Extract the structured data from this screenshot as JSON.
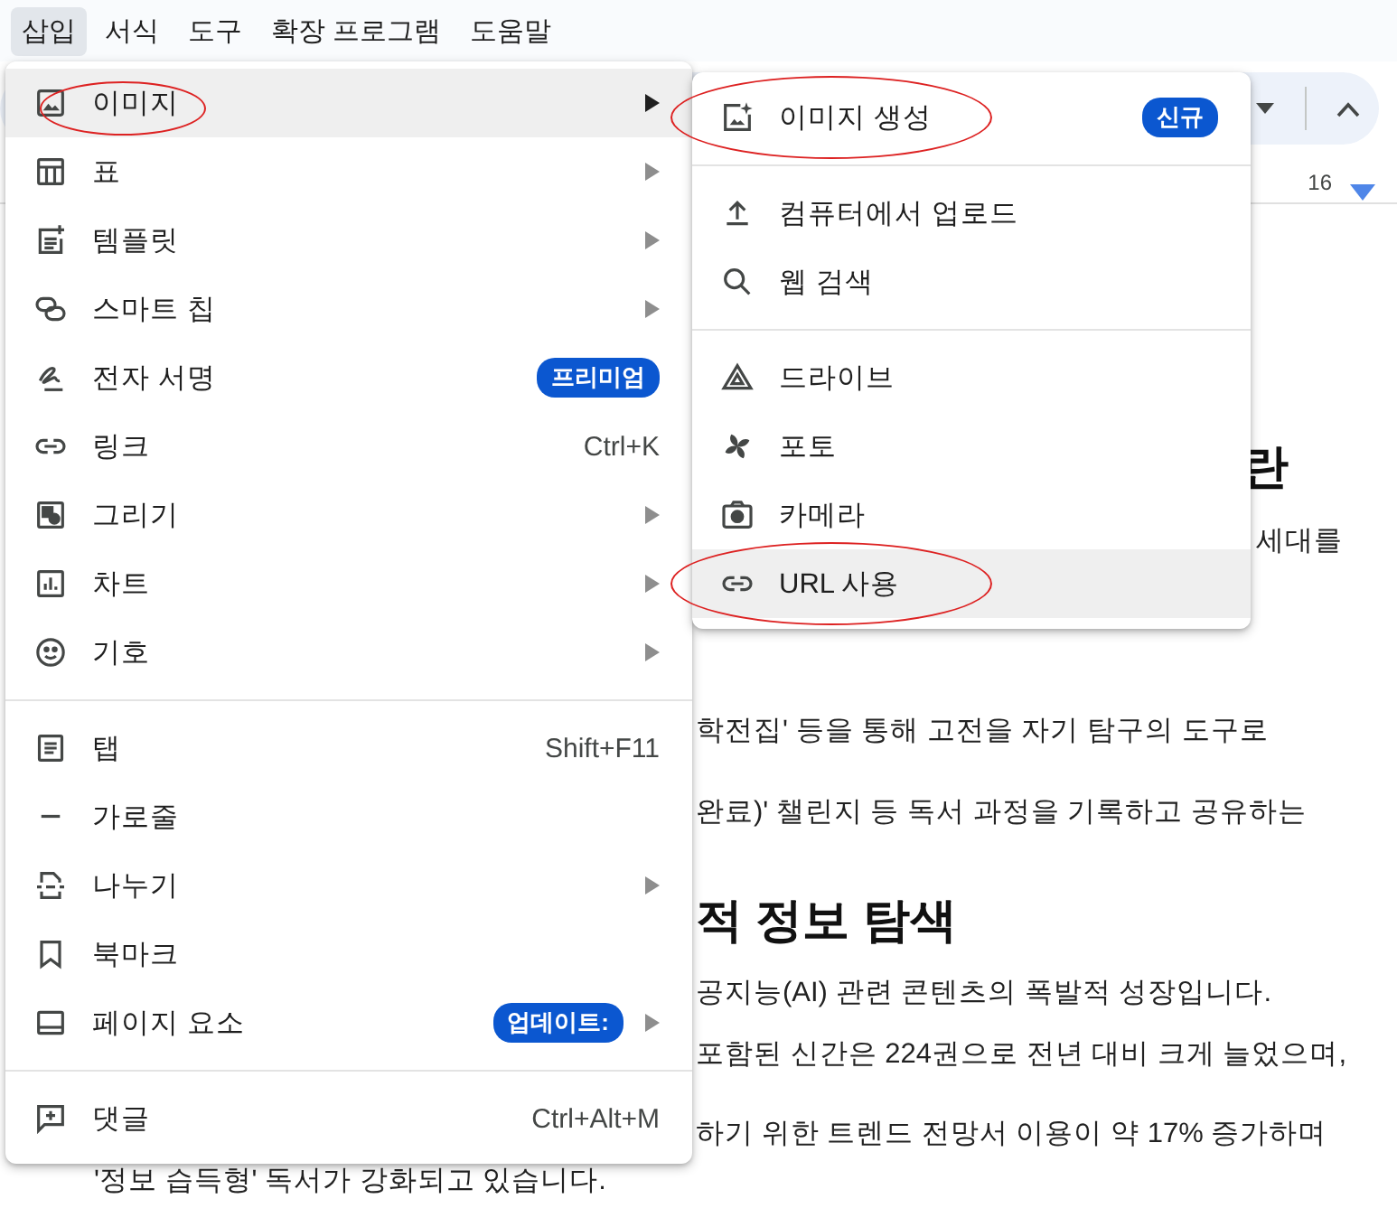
{
  "menubar": [
    {
      "label": "삽입",
      "selected": true
    },
    {
      "label": "서식",
      "selected": false
    },
    {
      "label": "도구",
      "selected": false
    },
    {
      "label": "확장 프로그램",
      "selected": false
    },
    {
      "label": "도움말",
      "selected": false
    }
  ],
  "ruler": {
    "tick_label": "16"
  },
  "document": {
    "lines": [
      {
        "kind": "heading",
        "text": "란"
      },
      {
        "kind": "text",
        "text": "세대를"
      },
      {
        "kind": "text",
        "text": "학전집' 등을 통해 고전을 자기 탐구의 도구로"
      },
      {
        "kind": "text",
        "text": "완료)' 챌린지 등 독서 과정을 기록하고 공유하는"
      },
      {
        "kind": "heading",
        "text": "적 정보 탐색"
      },
      {
        "kind": "text",
        "text": "공지능(AI) 관련 콘텐츠의 폭발적 성장입니다."
      },
      {
        "kind": "text",
        "text": "포함된 신간은 224권으로 전년 대비 크게 늘었으며,"
      },
      {
        "kind": "text",
        "text": "하기 위한 트렌드 전망서 이용이 약 17% 증가하며"
      },
      {
        "kind": "text",
        "text": "'정보 습득형' 독서가 강화되고 있습니다."
      }
    ]
  },
  "insert_menu": {
    "groups": [
      {
        "items": [
          {
            "label": "이미지",
            "has_submenu": true,
            "highlighted": true,
            "circled": true
          },
          {
            "label": "표",
            "has_submenu": true,
            "highlighted": false,
            "circled": false
          },
          {
            "label": "템플릿",
            "has_submenu": true,
            "highlighted": false,
            "circled": false
          },
          {
            "label": "스마트 칩",
            "has_submenu": true,
            "highlighted": false,
            "circled": false
          },
          {
            "label": "전자 서명",
            "badge": "프리미엄",
            "has_submenu": false,
            "highlighted": false,
            "circled": false
          },
          {
            "label": "링크",
            "shortcut": "Ctrl+K",
            "has_submenu": false,
            "highlighted": false,
            "circled": false
          },
          {
            "label": "그리기",
            "has_submenu": true,
            "highlighted": false,
            "circled": false
          },
          {
            "label": "차트",
            "has_submenu": true,
            "highlighted": false,
            "circled": false
          },
          {
            "label": "기호",
            "has_submenu": true,
            "highlighted": false,
            "circled": false
          }
        ]
      },
      {
        "items": [
          {
            "label": "탭",
            "shortcut": "Shift+F11",
            "has_submenu": false,
            "highlighted": false,
            "circled": false
          },
          {
            "label": "가로줄",
            "has_submenu": false,
            "highlighted": false,
            "circled": false
          },
          {
            "label": "나누기",
            "has_submenu": true,
            "highlighted": false,
            "circled": false
          },
          {
            "label": "북마크",
            "has_submenu": false,
            "highlighted": false,
            "circled": false
          },
          {
            "label": "페이지 요소",
            "badge": "업데이트:",
            "has_submenu": true,
            "highlighted": false,
            "circled": false
          }
        ]
      },
      {
        "items": [
          {
            "label": "댓글",
            "shortcut": "Ctrl+Alt+M",
            "has_submenu": false,
            "highlighted": false,
            "circled": false
          }
        ]
      }
    ]
  },
  "image_submenu": {
    "groups": [
      {
        "items": [
          {
            "label": "이미지 생성",
            "badge": "신규",
            "highlighted": false,
            "circled": true
          }
        ]
      },
      {
        "items": [
          {
            "label": "컴퓨터에서 업로드",
            "highlighted": false,
            "circled": false
          },
          {
            "label": "웹 검색",
            "highlighted": false,
            "circled": false
          }
        ]
      },
      {
        "items": [
          {
            "label": "드라이브",
            "highlighted": false,
            "circled": false
          },
          {
            "label": "포토",
            "highlighted": false,
            "circled": false
          },
          {
            "label": "카메라",
            "highlighted": false,
            "circled": false
          },
          {
            "label": "URL 사용",
            "highlighted": true,
            "circled": true
          }
        ]
      }
    ]
  }
}
